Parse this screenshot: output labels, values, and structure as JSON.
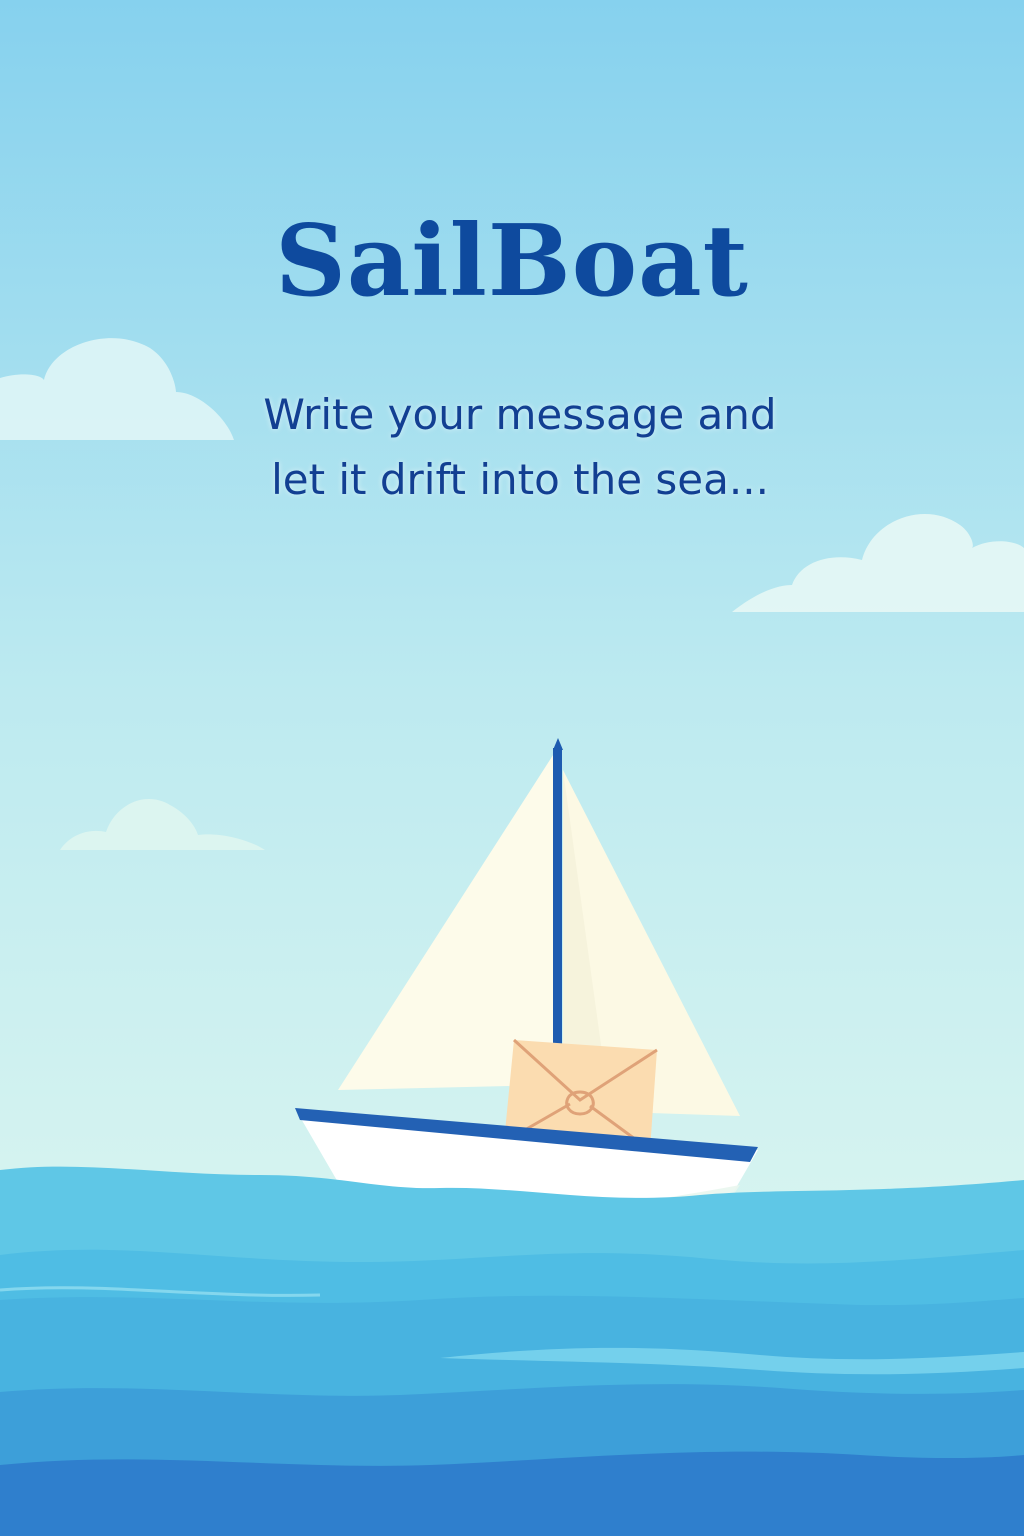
{
  "app": {
    "title": "SailBoat",
    "tagline_line1": "Write your message and",
    "tagline_line2": "let it drift into the sea..."
  },
  "colors": {
    "title_text": "#0e4a9e",
    "tagline_text": "#123f92",
    "sky_top": "#86d1ee",
    "sky_bottom": "#e6faf0",
    "cloud": "#dff5f6",
    "sail": "#fdfbea",
    "mast": "#1e5bb0",
    "hull": "#ffffff",
    "hull_stripe": "#2361b4",
    "envelope": "#fbdcb0",
    "envelope_lines": "#dfa278",
    "sea_light": "#5fc7e6",
    "sea_mid": "#45afe0",
    "sea_deep": "#2f7fcd"
  },
  "icons": [
    "sailboat-illustration",
    "envelope-icon",
    "cloud-icon"
  ]
}
